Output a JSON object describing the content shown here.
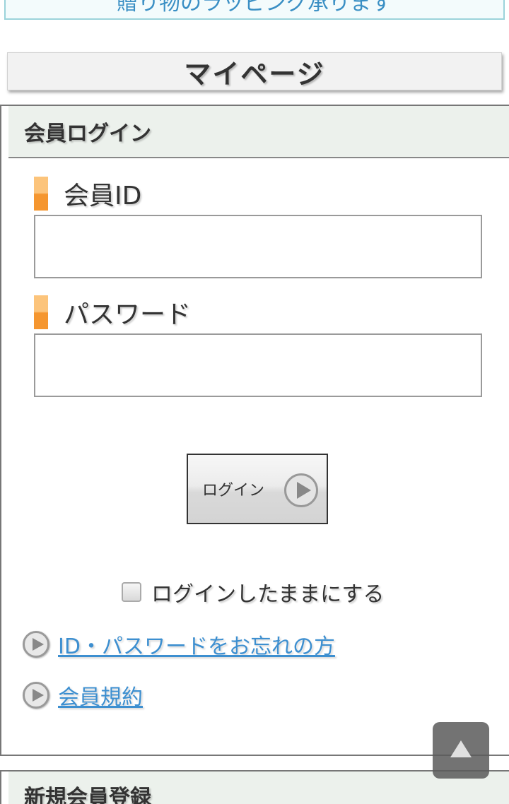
{
  "banner": {
    "text": "贈り物のラッピング承ります"
  },
  "header": {
    "title": "マイページ"
  },
  "login_section": {
    "title": "会員ログイン",
    "member_id_label": "会員ID",
    "member_id_value": "",
    "password_label": "パスワード",
    "password_value": "",
    "login_button_label": "ログイン",
    "remember_label": "ログインしたままにする",
    "remember_checked": false,
    "links": [
      {
        "label": "ID・パスワードをお忘れの方"
      },
      {
        "label": "会員規約"
      }
    ]
  },
  "register_section": {
    "title": "新規会員登録"
  },
  "icons": {
    "login": "play-circle-icon",
    "link": "arrow-circle-icon",
    "to_top": "up-arrow-icon"
  },
  "colors": {
    "accent_orange": "#f5962f",
    "link_blue": "#3d8fd0",
    "section_bg": "#ecf1ec"
  }
}
